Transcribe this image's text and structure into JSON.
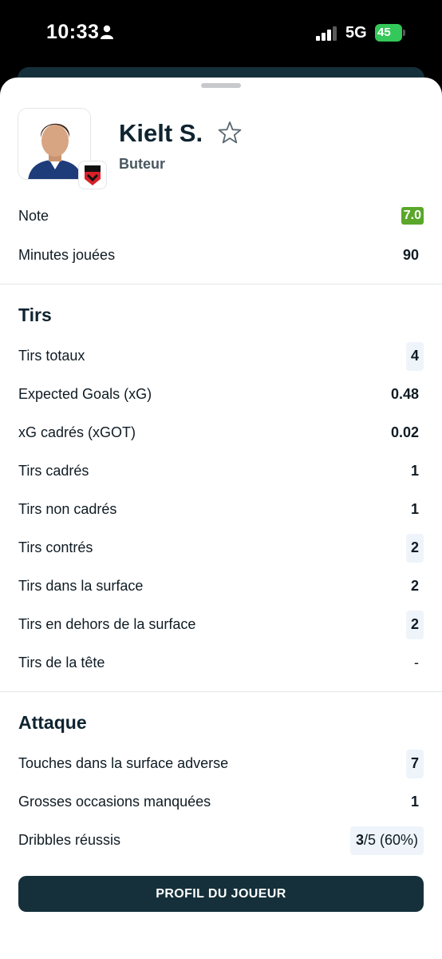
{
  "status_bar": {
    "time": "10:33",
    "network": "5G",
    "battery": "45"
  },
  "player": {
    "name": "Kielt S.",
    "position": "Buteur",
    "team_badge_text": "EAG"
  },
  "summary": [
    {
      "label": "Note",
      "value": "7.0"
    },
    {
      "label": "Minutes jouées",
      "value": "90"
    }
  ],
  "shots": {
    "title": "Tirs",
    "rows": [
      {
        "label": "Tirs totaux",
        "value": "4"
      },
      {
        "label": "Expected Goals (xG)",
        "value": "0.48"
      },
      {
        "label": "xG cadrés (xGOT)",
        "value": "0.02"
      },
      {
        "label": "Tirs cadrés",
        "value": "1"
      },
      {
        "label": "Tirs non cadrés",
        "value": "1"
      },
      {
        "label": "Tirs contrés",
        "value": "2"
      },
      {
        "label": "Tirs dans la surface",
        "value": "2"
      },
      {
        "label": "Tirs en dehors de la surface",
        "value": "2"
      },
      {
        "label": "Tirs de la tête",
        "value": "-"
      }
    ]
  },
  "attack": {
    "title": "Attaque",
    "rows": [
      {
        "label": "Touches dans la surface adverse",
        "value": "7"
      },
      {
        "label": "Grosses occasions manquées",
        "value": "1"
      },
      {
        "label": "Dribbles réussis",
        "value_success": "3",
        "value_total": "/5 (60%)"
      }
    ]
  },
  "profile_button_label": "PROFIL DU JOUEUR",
  "colors": {
    "rating": "#5aa72a",
    "button": "#15303a",
    "highlight": "#eef4fa"
  }
}
